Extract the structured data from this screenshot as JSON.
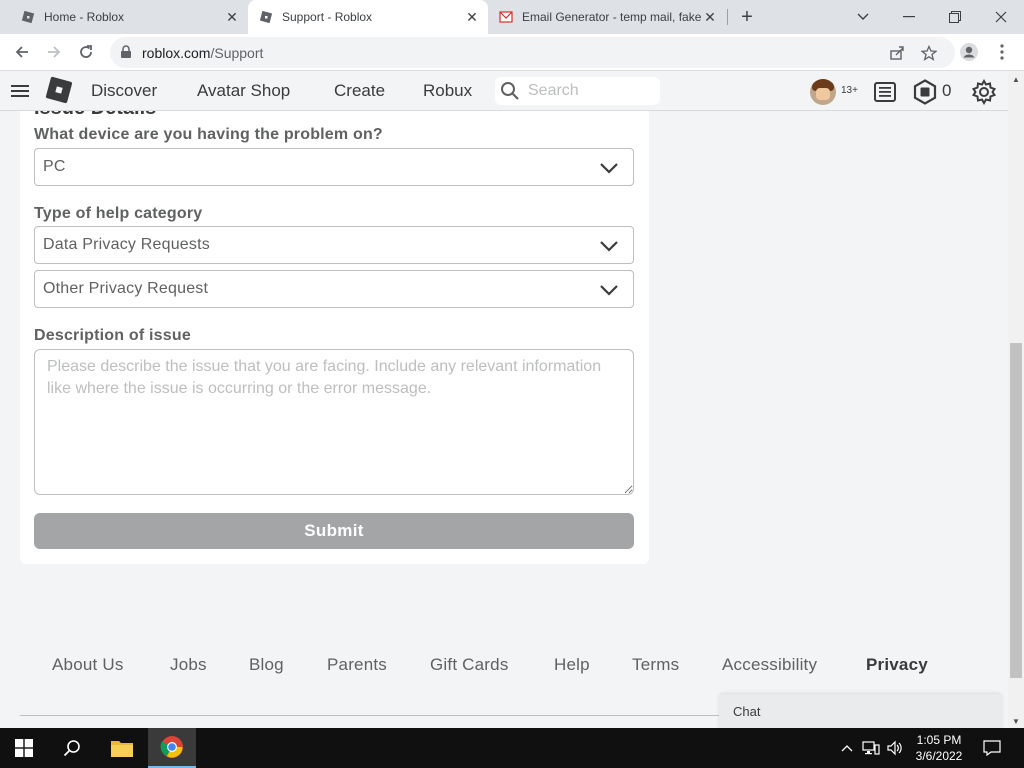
{
  "browser": {
    "tabs": [
      {
        "title": "Home - Roblox",
        "active": false
      },
      {
        "title": "Support - Roblox",
        "active": true
      },
      {
        "title": "Email Generator - temp mail, fake",
        "active": false
      }
    ],
    "url_host": "roblox.com",
    "url_path": "/Support"
  },
  "nav": {
    "links": [
      "Discover",
      "Avatar Shop",
      "Create",
      "Robux"
    ],
    "search_placeholder": "Search",
    "age_badge": "13+",
    "robux_count": "0"
  },
  "form": {
    "section_title": "Issue Details",
    "device_label": "What device are you having the problem on?",
    "device_value": "PC",
    "category_label": "Type of help category",
    "category_value": "Data Privacy Requests",
    "subcategory_value": "Other Privacy Request",
    "description_label": "Description of issue",
    "description_placeholder": "Please describe the issue that you are facing. Include any relevant information like where the issue is occurring or the error message.",
    "submit_label": "Submit"
  },
  "footer": {
    "links": [
      "About Us",
      "Jobs",
      "Blog",
      "Parents",
      "Gift Cards",
      "Help",
      "Terms",
      "Accessibility",
      "Privacy"
    ]
  },
  "chat": {
    "label": "Chat"
  },
  "taskbar": {
    "time": "1:05 PM",
    "date": "3/6/2022"
  },
  "colors": {
    "page_bg": "#f2f4f5",
    "submit_disabled": "#a3a5a6",
    "taskbar": "#101010"
  }
}
